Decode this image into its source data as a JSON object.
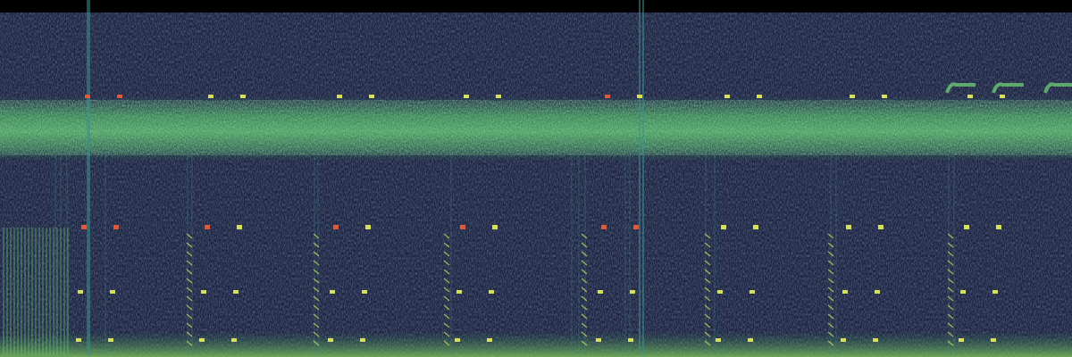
{
  "spectrogram": {
    "colors": {
      "top_bar": "#000000",
      "background": "#1c2440",
      "noise": "#232c4d",
      "band": "#3f9a5a",
      "band_bright": "#6cc870",
      "line": "#3d8f8c",
      "mark": "#d8e05a",
      "mark_hot": "#e0593a"
    }
  }
}
